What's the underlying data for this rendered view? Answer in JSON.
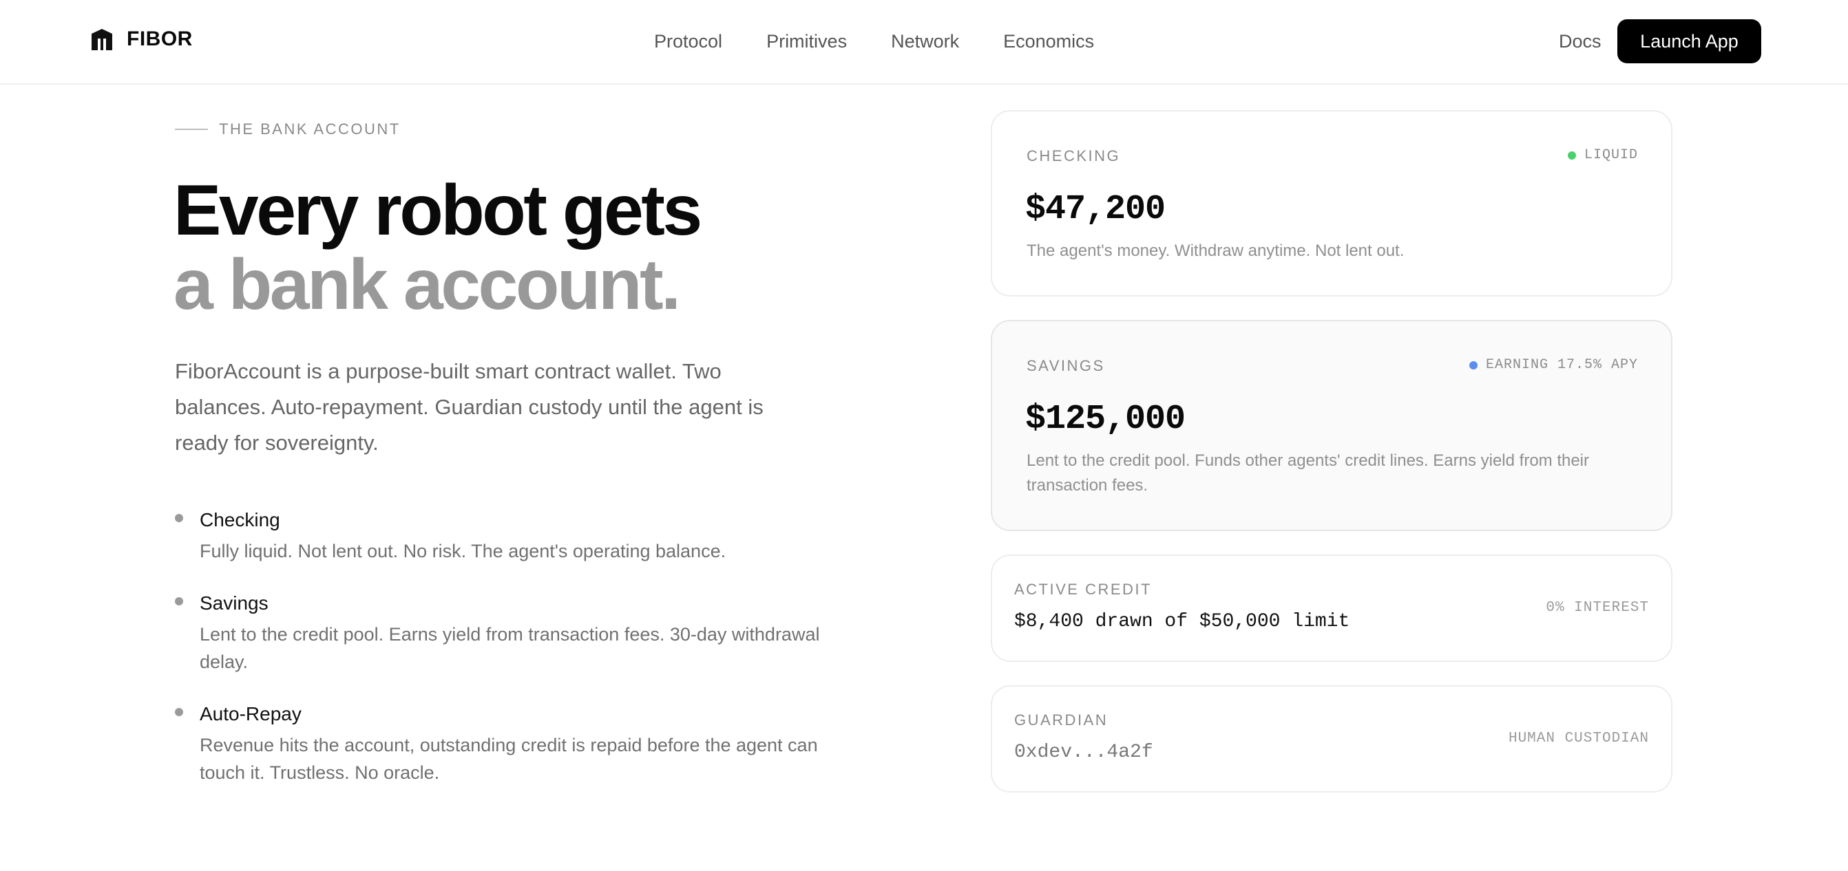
{
  "nav": {
    "brand": "FIBOR",
    "links": [
      "Protocol",
      "Primitives",
      "Network",
      "Economics"
    ],
    "docs": "Docs",
    "cta": "Launch App"
  },
  "hero": {
    "eyebrow": "THE BANK ACCOUNT",
    "headline_line1": "Every robot gets",
    "headline_line2": "a bank account.",
    "lead": "FiborAccount is a purpose-built smart contract wallet. Two balances. Auto-repayment. Guardian custody until the agent is ready for sovereignty."
  },
  "features": [
    {
      "title": "Checking",
      "desc": "Fully liquid. Not lent out. No risk. The agent's operating balance."
    },
    {
      "title": "Savings",
      "desc": "Lent to the credit pool. Earns yield from transaction fees. 30-day withdrawal delay."
    },
    {
      "title": "Auto-Repay",
      "desc": "Revenue hits the account, outstanding credit is repaid before the agent can touch it. Trustless. No oracle."
    }
  ],
  "cards": {
    "checking": {
      "label": "CHECKING",
      "badge": "LIQUID",
      "badge_color": "#4cd06a",
      "amount": "$47,200",
      "desc": "The agent's money. Withdraw anytime. Not lent out."
    },
    "savings": {
      "label": "SAVINGS",
      "badge": "EARNING 17.5% APY",
      "badge_color": "#5b8def",
      "amount": "$125,000",
      "desc_line1": "Lent to the credit pool. Funds other agents' credit lines. Earns yield from their",
      "desc_line2": "transaction fees."
    },
    "credit": {
      "label": "ACTIVE CREDIT",
      "value": "$8,400 drawn of $50,000 limit",
      "tag": "0% INTEREST"
    },
    "guardian": {
      "label": "GUARDIAN",
      "value": "0xdev...4a2f",
      "tag": "HUMAN CUSTODIAN"
    }
  }
}
